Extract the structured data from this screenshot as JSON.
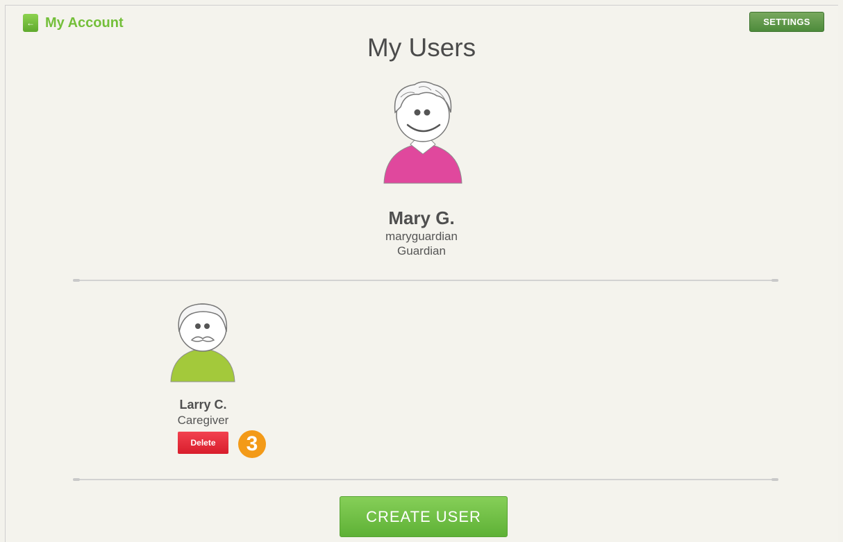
{
  "header": {
    "back_label": "My Account",
    "back_icon": "←",
    "settings_label": "SETTINGS"
  },
  "page": {
    "title": "My Users"
  },
  "primary_user": {
    "name": "Mary G.",
    "username": "maryguardian",
    "role": "Guardian"
  },
  "users": [
    {
      "name": "Larry C.",
      "role": "Caregiver",
      "delete_label": "Delete"
    }
  ],
  "annotation": {
    "label": "3",
    "color": "#f39a18"
  },
  "actions": {
    "create_label": "CREATE USER"
  },
  "colors": {
    "accent_green": "#74bf3a",
    "mary_shirt": "#e0489d",
    "larry_shirt": "#a3c93b",
    "delete_red": "#e12a37"
  }
}
